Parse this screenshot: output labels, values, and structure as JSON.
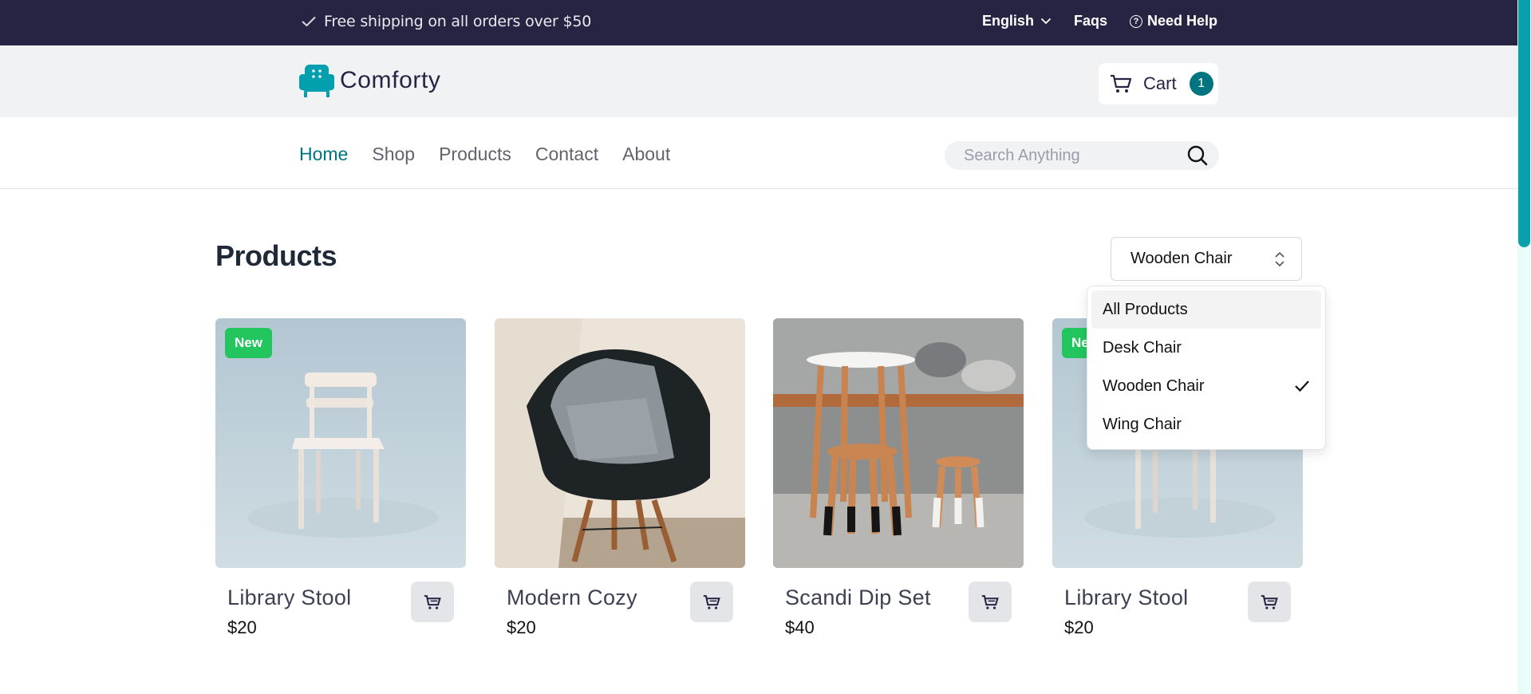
{
  "topbar": {
    "shipping_text": "Free shipping on all orders over $50",
    "language": "English",
    "faqs": "Faqs",
    "help": "Need Help"
  },
  "brand": {
    "name": "Comforty",
    "cart_label": "Cart",
    "cart_count": "1"
  },
  "nav": {
    "items": [
      "Home",
      "Shop",
      "Products",
      "Contact",
      "About"
    ],
    "active": "Home",
    "search_placeholder": "Search Anything"
  },
  "products": {
    "heading": "Products",
    "filter_value": "Wooden Chair",
    "filter_options": [
      "All Products",
      "Desk Chair",
      "Wooden Chair",
      "Wing Chair"
    ],
    "filter_selected": "Wooden Chair",
    "items": [
      {
        "name": "Library Stool",
        "price": "$20",
        "tag": "New"
      },
      {
        "name": "Modern Cozy",
        "price": "$20",
        "tag": ""
      },
      {
        "name": "Scandi Dip Set",
        "price": "$40",
        "tag": ""
      },
      {
        "name": "Library Stool",
        "price": "$20",
        "tag": "New"
      }
    ]
  },
  "colors": {
    "topbar": "#272343",
    "accent": "#007580",
    "new_tag": "#22c55e",
    "brand_bar": "#f0f2f3"
  },
  "icons": {
    "shipping": "check-icon",
    "language": "chevron-down-icon",
    "help": "question-circle-icon",
    "logo": "armchair-logo-icon",
    "cart": "cart-icon",
    "search": "search-icon",
    "select": "chevron-up-down-icon",
    "selected_option": "check-icon"
  }
}
